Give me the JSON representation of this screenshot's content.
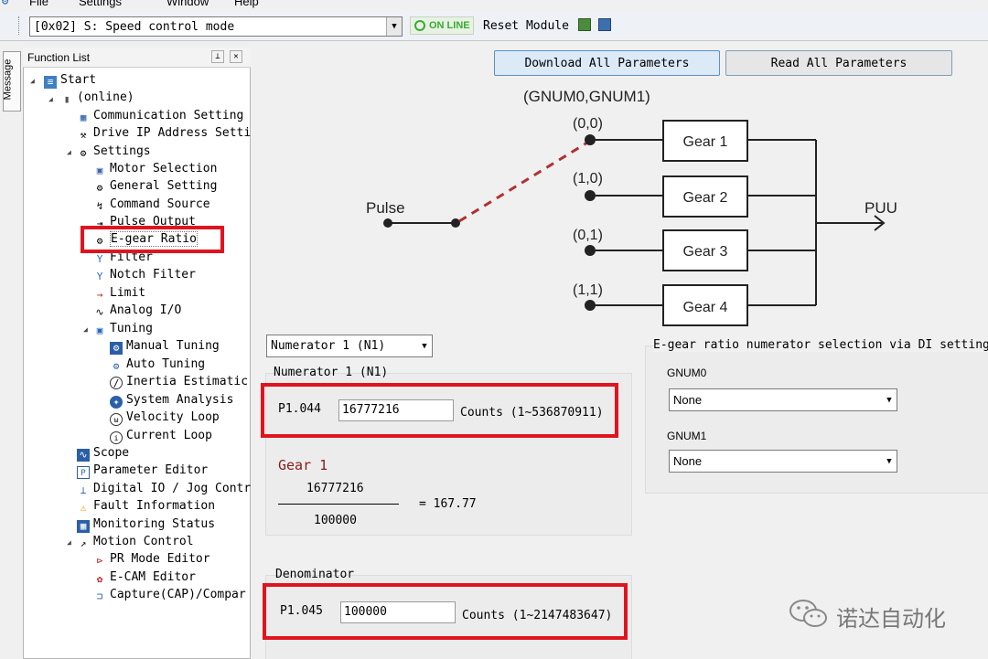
{
  "menu": {
    "file": "File",
    "settings": "Settings",
    "window": "Window",
    "help": "Help"
  },
  "toolbar": {
    "mode_select": "[0x02] S: Speed control mode",
    "online_status": "ON LINE",
    "reset_module": "Reset Module"
  },
  "side_tab": "Message",
  "function_list": {
    "title": "Function List",
    "items": [
      {
        "label": "Start"
      },
      {
        "label": "(online)"
      },
      {
        "label": "Communication Setting"
      },
      {
        "label": "Drive IP Address Setti"
      },
      {
        "label": "Settings"
      },
      {
        "label": "Motor Selection"
      },
      {
        "label": "General Setting"
      },
      {
        "label": "Command Source"
      },
      {
        "label": "Pulse Output"
      },
      {
        "label": "E-gear Ratio"
      },
      {
        "label": "Filter"
      },
      {
        "label": "Notch Filter"
      },
      {
        "label": "Limit"
      },
      {
        "label": "Analog I/O"
      },
      {
        "label": "Tuning"
      },
      {
        "label": "Manual Tuning"
      },
      {
        "label": "Auto Tuning"
      },
      {
        "label": "Inertia Estimatic"
      },
      {
        "label": "System Analysis"
      },
      {
        "label": "Velocity Loop"
      },
      {
        "label": "Current Loop"
      },
      {
        "label": "Scope"
      },
      {
        "label": "Parameter Editor"
      },
      {
        "label": "Digital IO / Jog Contr"
      },
      {
        "label": "Fault Information"
      },
      {
        "label": "Monitoring Status"
      },
      {
        "label": "Motion Control"
      },
      {
        "label": "PR Mode Editor"
      },
      {
        "label": "E-CAM Editor"
      },
      {
        "label": "Capture(CAP)/Compar"
      }
    ]
  },
  "buttons": {
    "download_all": "Download All Parameters",
    "read_all": "Read All Parameters"
  },
  "diagram": {
    "header": "(GNUM0,GNUM1)",
    "input": "Pulse",
    "output": "PUU",
    "states": [
      "(0,0)",
      "(1,0)",
      "(0,1)",
      "(1,1)"
    ],
    "gears": [
      "Gear 1",
      "Gear 2",
      "Gear 3",
      "Gear 4"
    ],
    "colors": {
      "switch_link": "#b03030"
    }
  },
  "numerator": {
    "select": "Numerator 1 (N1)",
    "group_title": "Numerator 1 (N1)",
    "param": "P1.044",
    "value": "16777216",
    "range": "Counts (1~536870911)"
  },
  "gear_result": {
    "title": "Gear 1",
    "numerator": "16777216",
    "denominator": "100000",
    "result": "= 167.77"
  },
  "denominator": {
    "group_title": "Denominator",
    "param": "P1.045",
    "value": "100000",
    "range": "Counts (1~2147483647)"
  },
  "di_settings": {
    "title": "E-gear ratio numerator selection via DI setting",
    "gnum0_label": "GNUM0",
    "gnum0_value": "None",
    "gnum1_label": "GNUM1",
    "gnum1_value": "None"
  },
  "watermark": "诺达自动化",
  "highlight_color": "#e0141e"
}
